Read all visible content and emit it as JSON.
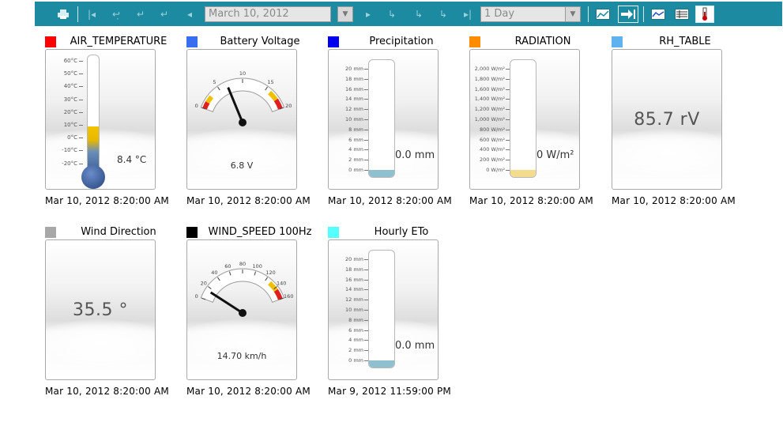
{
  "toolbar": {
    "date_value": "March 10, 2012",
    "range_value": "1 Day",
    "buttons": [
      "print-icon",
      "first-icon",
      "back-day-icon",
      "back-hour-icon",
      "back-step-icon",
      "prev-icon",
      "next-icon",
      "forward-step-icon",
      "forward-hour-icon",
      "forward-day-icon",
      "last-icon",
      "graph-icon",
      "live-icon",
      "chart-icon",
      "table-icon",
      "gauge-icon"
    ]
  },
  "widgets": [
    {
      "title": "AIR_TEMPERATURE",
      "swatch": "#ff0000",
      "type": "thermometer",
      "value_text": "8.4 °C",
      "value": 8.4,
      "scale": [
        "60°C",
        "50°C",
        "40°C",
        "30°C",
        "20°C",
        "10°C",
        "0°C",
        "-10°C",
        "-20°C"
      ],
      "time": "Mar 10, 2012 8:20:00 AM"
    },
    {
      "title": "Battery Voltage",
      "swatch": "#3a6ef0",
      "type": "gauge",
      "value_text": "6.8 V",
      "value": 6.8,
      "scale": [
        "0",
        "5",
        "10",
        "15",
        "20"
      ],
      "time": "Mar 10, 2012 8:20:00 AM"
    },
    {
      "title": "Precipitation",
      "swatch": "#0000ee",
      "type": "tube",
      "value_text": "0.0 mm",
      "value": 0.0,
      "scale": [
        "20 mm",
        "18 mm",
        "16 mm",
        "14 mm",
        "12 mm",
        "10 mm",
        "8 mm",
        "6 mm",
        "4 mm",
        "2 mm",
        "0 mm"
      ],
      "time": "Mar 10, 2012 8:20:00 AM",
      "fill_color": "#8fc0d0"
    },
    {
      "title": "RADIATION",
      "swatch": "#ff8c00",
      "type": "tube",
      "value_text": "0 W/m²",
      "value": 0,
      "scale": [
        "2,000 W/m²",
        "1,800 W/m²",
        "1,600 W/m²",
        "1,400 W/m²",
        "1,200 W/m²",
        "1,000 W/m²",
        "800 W/m²",
        "600 W/m²",
        "400 W/m²",
        "200 W/m²",
        "0 W/m²"
      ],
      "time": "Mar 10, 2012 8:20:00 AM",
      "fill_color": "#f3dc8e"
    },
    {
      "title": "RH_TABLE",
      "swatch": "#5fb2ee",
      "type": "text",
      "value_text": "85.7 rV",
      "time": "Mar 10, 2012 8:20:00 AM"
    },
    {
      "title": "Wind Direction",
      "swatch": "#a8a8a8",
      "type": "text",
      "value_text": "35.5 °",
      "time": "Mar 10, 2012 8:20:00 AM"
    },
    {
      "title": "WIND_SPEED 100Hz",
      "swatch": "#000000",
      "type": "gauge",
      "value_text": "14.70 km/h",
      "value": 14.7,
      "scale": [
        "0",
        "20",
        "40",
        "60",
        "80",
        "100",
        "120",
        "140",
        "160"
      ],
      "time": "Mar 10, 2012 8:20:00 AM"
    },
    {
      "title": "Hourly ETo",
      "swatch": "#55ffff",
      "type": "tube",
      "value_text": "0.0 mm",
      "value": 0.0,
      "scale": [
        "20 mm",
        "18 mm",
        "16 mm",
        "14 mm",
        "12 mm",
        "10 mm",
        "8 mm",
        "6 mm",
        "4 mm",
        "2 mm",
        "0 mm"
      ],
      "time": "Mar 9, 2012 11:59:00 PM",
      "fill_color": "#8fc0d0"
    }
  ]
}
